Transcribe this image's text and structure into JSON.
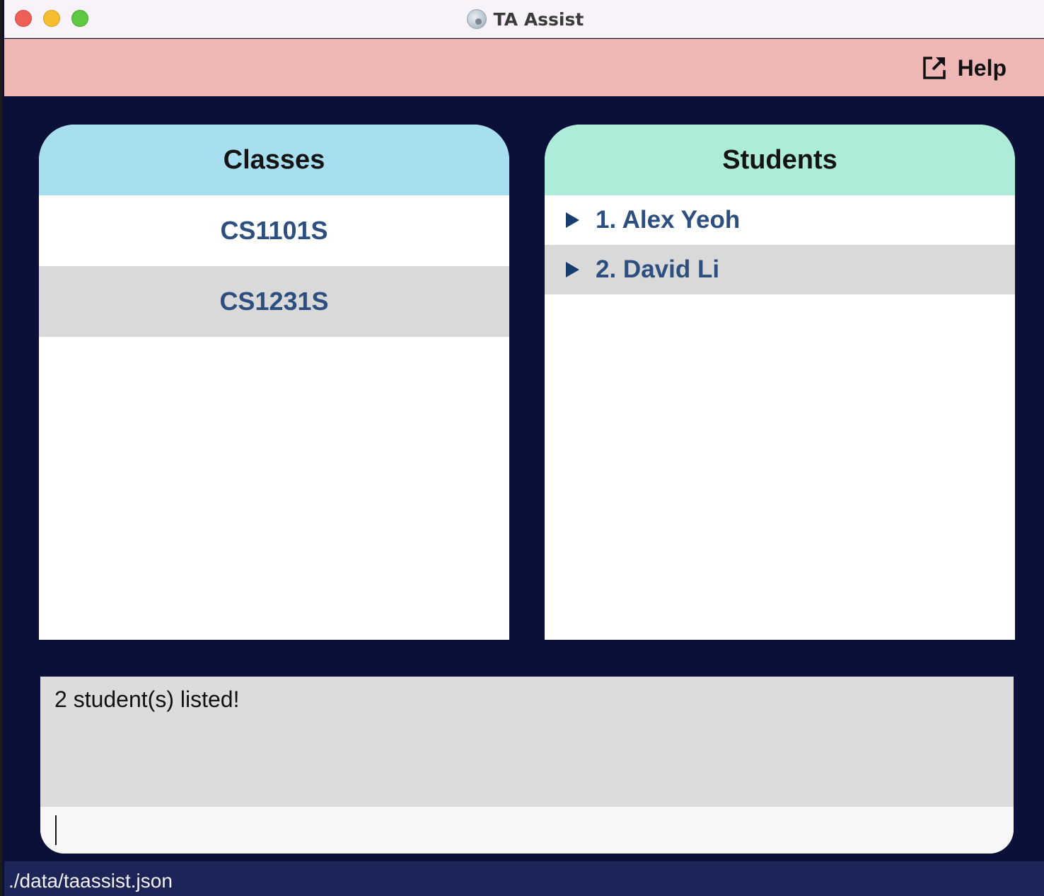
{
  "window": {
    "title": "TA Assist"
  },
  "menubar": {
    "help_label": "Help"
  },
  "classes": {
    "header": "Classes",
    "items": [
      "CS1101S",
      "CS1231S"
    ]
  },
  "students": {
    "header": "Students",
    "items": [
      "1. Alex Yeoh",
      "2. David Li"
    ]
  },
  "result": {
    "message": "2 student(s) listed!"
  },
  "command": {
    "value": ""
  },
  "status": {
    "file_path": "./data/taassist.json"
  },
  "colors": {
    "menubar_bg": "#efb6b6",
    "app_bg": "#0a1038",
    "classes_header_bg": "#a8dff0",
    "students_header_bg": "#adecd8",
    "item_text": "#2c4f80",
    "status_bg": "#1c2458"
  },
  "icons": {
    "help": "external-link-icon",
    "student_expand": "triangle-right-icon"
  }
}
